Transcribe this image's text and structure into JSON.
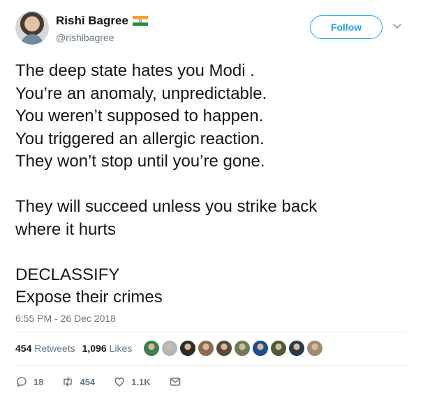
{
  "user": {
    "display_name": "Rishi Bagree",
    "handle": "@rishibagree",
    "flag_icon": "india-flag-icon"
  },
  "follow_label": "Follow",
  "tweet": {
    "lines": [
      "The deep state hates you Modi .",
      "You’re an anomaly, unpredictable.",
      "You weren’t supposed to happen.",
      "You triggered an allergic reaction.",
      "They won’t stop until you’re gone.",
      "",
      "They will succeed unless you strike back",
      "where it hurts",
      "",
      "DECLASSIFY",
      "Expose their crimes"
    ]
  },
  "timestamp": "6:55 PM - 26 Dec 2018",
  "stats": {
    "retweets_count": "454",
    "retweets_label": "Retweets",
    "likes_count": "1,096",
    "likes_label": "Likes"
  },
  "liker_avatars": [
    "#3f7f4d",
    "#b0b6bb",
    "#2f2a26",
    "#8c6b4f",
    "#5a4a3c",
    "#6d7c55",
    "#1d4f8c",
    "#4d5a3a",
    "#2b3a49",
    "#a08b6e"
  ],
  "actions": {
    "reply_count": "18",
    "retweet_count": "454",
    "like_count": "1.1K"
  },
  "colors": {
    "accent": "#1da1f2",
    "muted": "#657786",
    "text": "#14171a",
    "divider": "#e6ecf0"
  }
}
